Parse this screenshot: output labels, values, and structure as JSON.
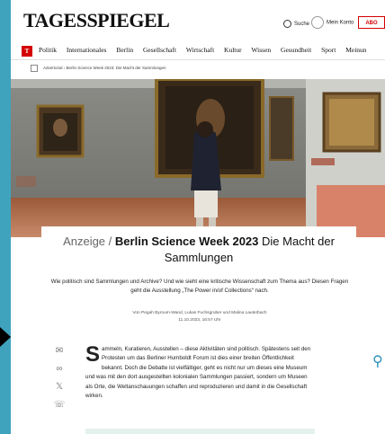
{
  "header": {
    "logo": "TAGESSPIEGEL",
    "search_label": "Suche",
    "account_label": "Mein Konto",
    "abo_label": "ABO"
  },
  "nav": {
    "logo_letter": "T",
    "items": [
      "Politik",
      "Internationales",
      "Berlin",
      "Gesellschaft",
      "Wirtschaft",
      "Kultur",
      "Wissen",
      "Gesundheit",
      "Sport",
      "Meinun"
    ]
  },
  "breadcrumb": {
    "items": [
      "Advertorial",
      "Berlin Science Week 2023: Die Macht der Sammlungen"
    ]
  },
  "article": {
    "kicker": "Anzeige",
    "separator": "/",
    "headline_bold": "Berlin Science Week 2023",
    "headline_rest": "Die Macht der Sammlungen",
    "teaser": "Wie politisch sind Sammlungen und Archive? Und wie sieht eine kritische Wissenschaft zum Thema aus? Diesen Fragen geht die Ausstellung „The Power in/of Collections“ nach.",
    "byline": "Von Pegah Byroum-Wand, Lukas Fuchsgruber und Malina Lauterbach",
    "date": "11.10.2023, 16:57 Uhr",
    "dropcap": "S",
    "body": "ammeln, Kuratieren, Ausstellen – diese Aktivitäten sind politisch. Spätestens seit den Protesten um das Berliner Humboldt Forum ist dies einer breiten Öffentlichkeit bekannt. Doch die Debatte ist vielfältiger, geht es nicht nur um dieses eine Museum und was mit den dort ausgestellten kolonialen Sammlungen passiert, sondern um Museen als Orte, die Weltanschauungen schaffen und reproduzieren und damit in die Gesellschaft wirken."
  },
  "share_icons": [
    "mail-icon",
    "link-icon",
    "x-icon",
    "whatsapp-icon"
  ],
  "colors": {
    "background": "#3fa3bd",
    "brand_red": "#d40000"
  }
}
